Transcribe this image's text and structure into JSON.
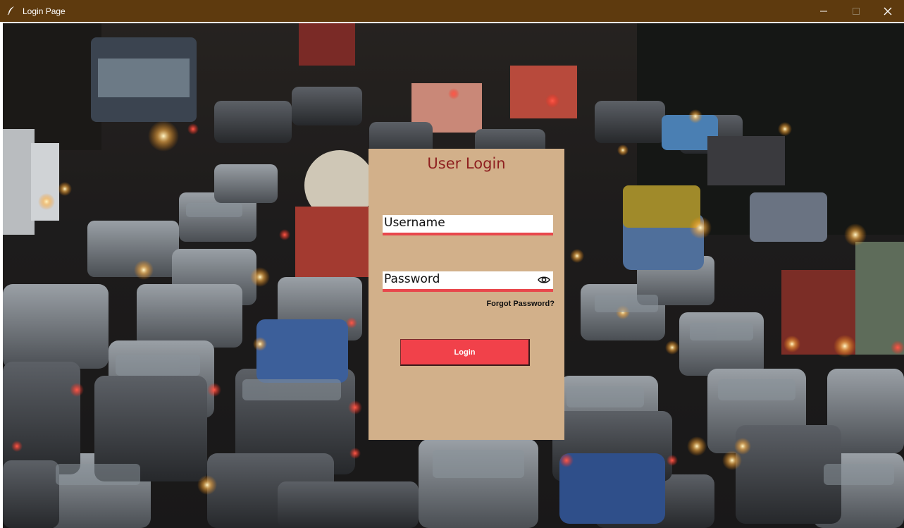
{
  "window": {
    "title": "Login Page",
    "icons": {
      "app": "feather-icon",
      "minimize": "minimize-icon",
      "maximize": "maximize-icon",
      "close": "close-icon"
    }
  },
  "background": {
    "description_icon": "traffic-photo"
  },
  "login": {
    "title": "User Login",
    "username_placeholder": "Username",
    "password_placeholder": "Password",
    "forgot_label": "Forgot Password?",
    "button_label": "Login",
    "colors": {
      "panel": "#d2b08a",
      "title": "#8e1f1f",
      "accent": "#e8474c",
      "button": "#f1414a"
    }
  }
}
